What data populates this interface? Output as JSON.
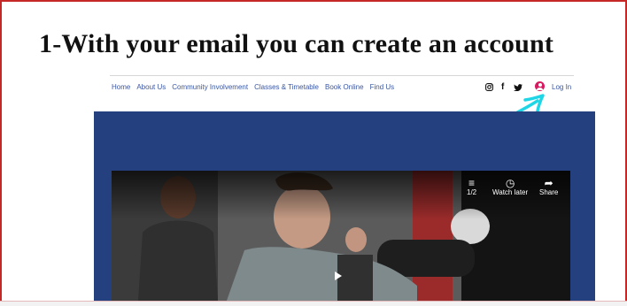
{
  "heading": "1-With your email you can create an account",
  "nav": {
    "items": [
      "Home",
      "About Us",
      "Community Involvement",
      "Classes & Timetable",
      "Book Online",
      "Find Us"
    ],
    "login_label": "Log In"
  },
  "social": {
    "instagram": "◎",
    "facebook": "f",
    "twitter": "🐦"
  },
  "video": {
    "playlist_count": "1/2",
    "watch_later_label": "Watch later",
    "share_label": "Share"
  },
  "colors": {
    "hero_blue": "#25407f",
    "nav_link": "#3a57a5",
    "annotation_arrow": "#1fd6e6",
    "login_icon": "#d81b60",
    "frame_border": "#c62828"
  }
}
